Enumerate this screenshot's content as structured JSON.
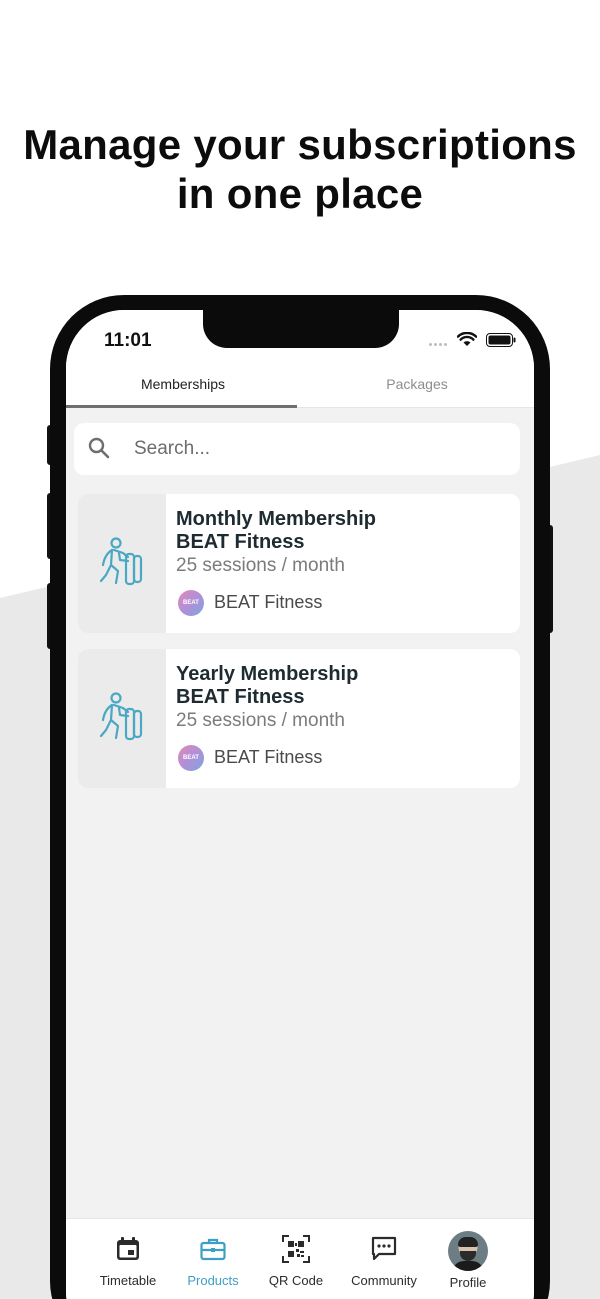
{
  "headline": {
    "line1": "Manage your subscriptions",
    "line2": "in one place"
  },
  "status_bar": {
    "time": "11:01"
  },
  "tabs": [
    {
      "label": "Memberships",
      "active": true
    },
    {
      "label": "Packages",
      "active": false
    }
  ],
  "search": {
    "placeholder": "Search..."
  },
  "memberships": [
    {
      "title_line1": "Monthly Membership",
      "title_line2": "BEAT Fitness",
      "sessions": "25 sessions / month",
      "provider": "BEAT Fitness",
      "provider_logo_text": "BEAT",
      "icon": "weightlifter-icon"
    },
    {
      "title_line1": "Yearly Membership",
      "title_line2": "BEAT Fitness",
      "sessions": "25 sessions / month",
      "provider": "BEAT Fitness",
      "provider_logo_text": "BEAT",
      "icon": "weightlifter-icon"
    }
  ],
  "bottom_nav": [
    {
      "label": "Timetable",
      "icon": "calendar-icon",
      "active": false
    },
    {
      "label": "Products",
      "icon": "briefcase-icon",
      "active": true
    },
    {
      "label": "QR Code",
      "icon": "qr-code-icon",
      "active": false
    },
    {
      "label": "Community",
      "icon": "chat-icon",
      "active": false
    },
    {
      "label": "Profile",
      "icon": "avatar",
      "active": false
    }
  ],
  "colors": {
    "accent": "#3e9fc5",
    "icon_teal": "#4aa8c4",
    "title_text": "#1e2b30",
    "background_gray": "#e9e9ea"
  }
}
